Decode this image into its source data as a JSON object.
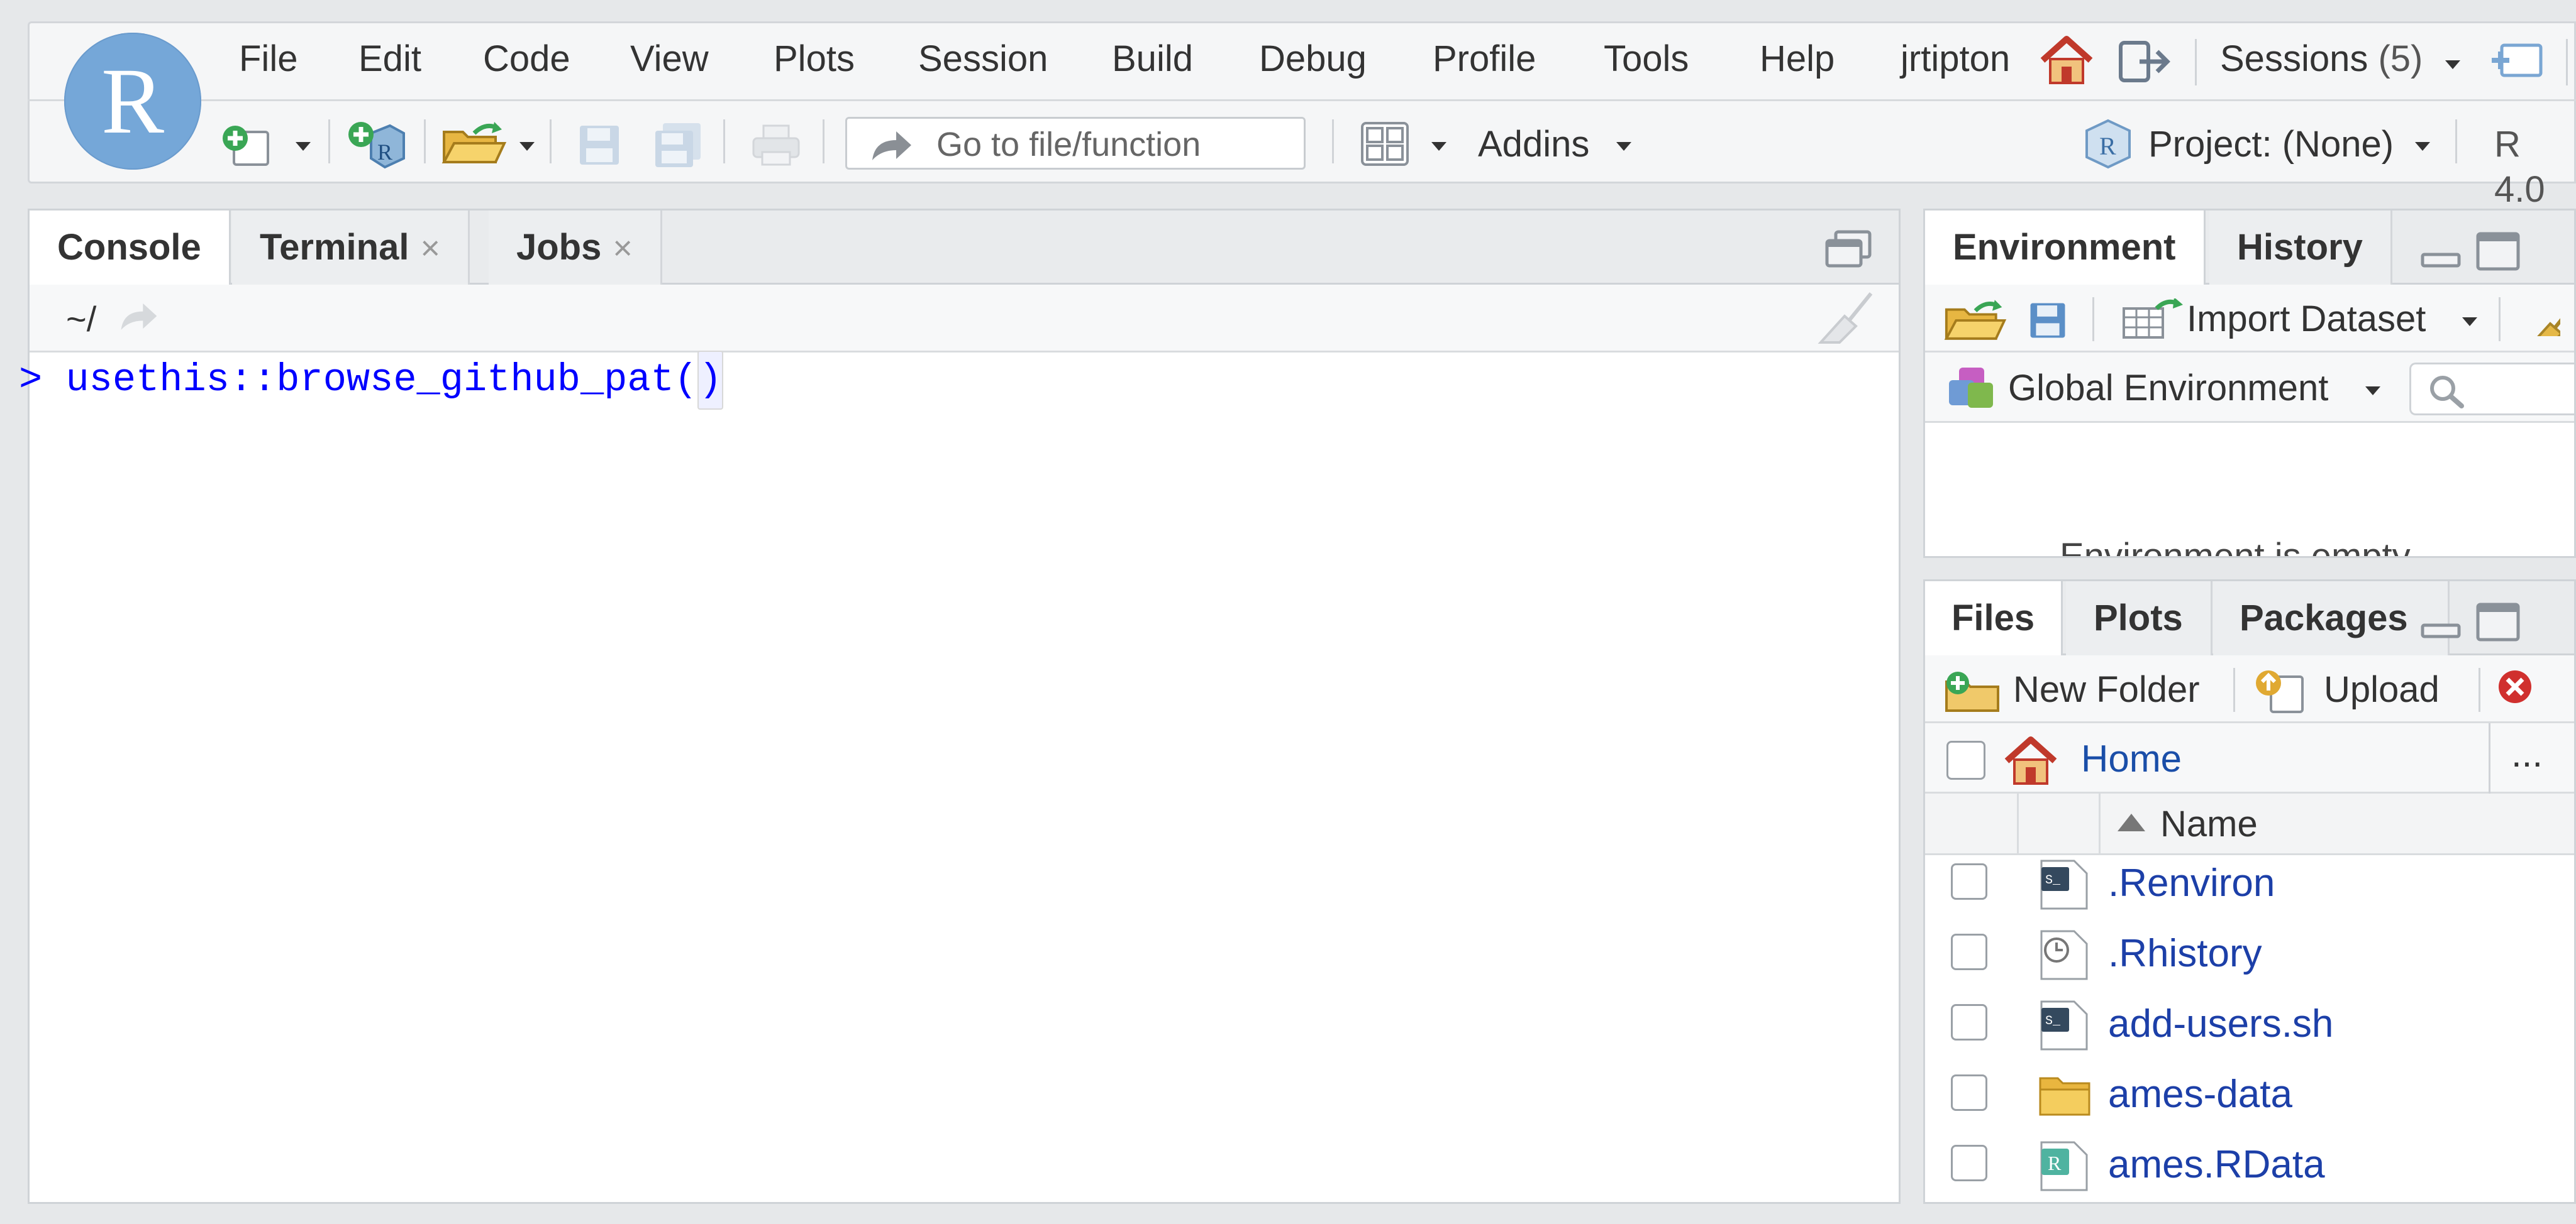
{
  "menubar": {
    "logo_letter": "R",
    "items": [
      "File",
      "Edit",
      "Code",
      "View",
      "Plots",
      "Session",
      "Build",
      "Debug",
      "Profile",
      "Tools",
      "Help"
    ],
    "user": "jrtipton",
    "sessions_label": "Sessions",
    "sessions_count": "(5)"
  },
  "toolbar": {
    "goto_placeholder": "Go to file/function",
    "addins_label": "Addins",
    "project_label": "Project: (None)",
    "r_version": "R 4.0"
  },
  "console_pane": {
    "tabs": [
      {
        "label": "Console",
        "active": true,
        "closable": false
      },
      {
        "label": "Terminal",
        "active": false,
        "closable": true
      },
      {
        "label": "Jobs",
        "active": false,
        "closable": true
      }
    ],
    "close_glyph": "×",
    "working_dir": "~/",
    "prompt": ">",
    "command": "usethis::browse_github_pat(",
    "command_tail": ")"
  },
  "env_pane": {
    "tabs": [
      {
        "label": "Environment",
        "active": true
      },
      {
        "label": "History",
        "active": false
      }
    ],
    "import_dataset_label": "Import Dataset",
    "global_env_label": "Global Environment",
    "empty_text_partial": "Environment is empty"
  },
  "files_pane": {
    "tabs": [
      {
        "label": "Files",
        "active": true
      },
      {
        "label": "Plots",
        "active": false
      },
      {
        "label": "Packages",
        "active": false
      }
    ],
    "new_folder_label": "New Folder",
    "upload_label": "Upload",
    "breadcrumb_home": "Home",
    "more_label": "...",
    "column_name": "Name",
    "files": [
      {
        "name": ".Renviron",
        "icon": "shell-script-icon"
      },
      {
        "name": ".Rhistory",
        "icon": "history-file-icon"
      },
      {
        "name": "add-users.sh",
        "icon": "shell-script-icon"
      },
      {
        "name": "ames-data",
        "icon": "folder-icon"
      },
      {
        "name": "ames.RData",
        "icon": "rdata-file-icon"
      }
    ]
  },
  "colors": {
    "logo_blue": "#75a7d8",
    "console_command": "#0000ff",
    "file_link": "#1c3fa8"
  }
}
